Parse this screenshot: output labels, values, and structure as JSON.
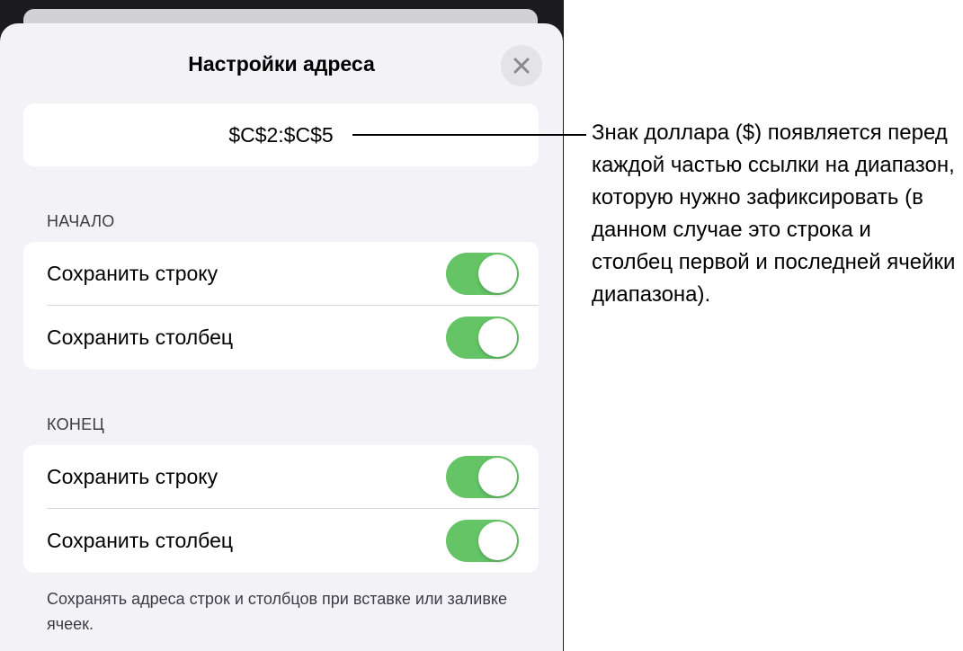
{
  "sheet": {
    "title": "Настройки адреса",
    "address": "$C$2:$C$5"
  },
  "start": {
    "header": "НАЧАЛО",
    "rows": [
      {
        "label": "Сохранить строку",
        "on": true
      },
      {
        "label": "Сохранить столбец",
        "on": true
      }
    ]
  },
  "end": {
    "header": "КОНЕЦ",
    "rows": [
      {
        "label": "Сохранить строку",
        "on": true
      },
      {
        "label": "Сохранить столбец",
        "on": true
      }
    ]
  },
  "footer_note": "Сохранять адреса строк и столбцов при вставке или заливке ячеек.",
  "callout": "Знак доллара ($) появляется перед каждой частью ссылки на диапазон, которую нужно зафиксировать (в данном случае это строка и столбец первой и последней ячейки диапазона).",
  "colors": {
    "toggle_on": "#65c466",
    "sheet_bg": "#f2f2f7"
  }
}
